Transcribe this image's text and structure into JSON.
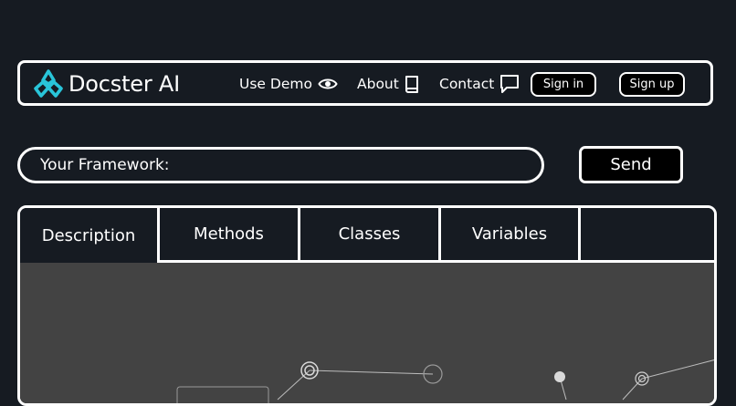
{
  "nav": {
    "brand": "Docster AI",
    "brand_icon": "docster-logo-icon",
    "accent_color": "#29c5d9",
    "links": [
      {
        "label": "Use Demo",
        "icon": "eye-icon"
      },
      {
        "label": "About",
        "icon": "book-icon"
      },
      {
        "label": "Contact",
        "icon": "chat-bubble-icon"
      }
    ],
    "sign_in": "Sign in",
    "sign_up": "Sign up"
  },
  "search": {
    "placeholder": "Your Framework:",
    "value": "",
    "send_label": "Send"
  },
  "tabs": [
    {
      "label": "Description",
      "active": true
    },
    {
      "label": "Methods",
      "active": false
    },
    {
      "label": "Classes",
      "active": false
    },
    {
      "label": "Variables",
      "active": false
    }
  ],
  "graph": {
    "background": "#434343",
    "node_color": "#d9d9d9"
  }
}
